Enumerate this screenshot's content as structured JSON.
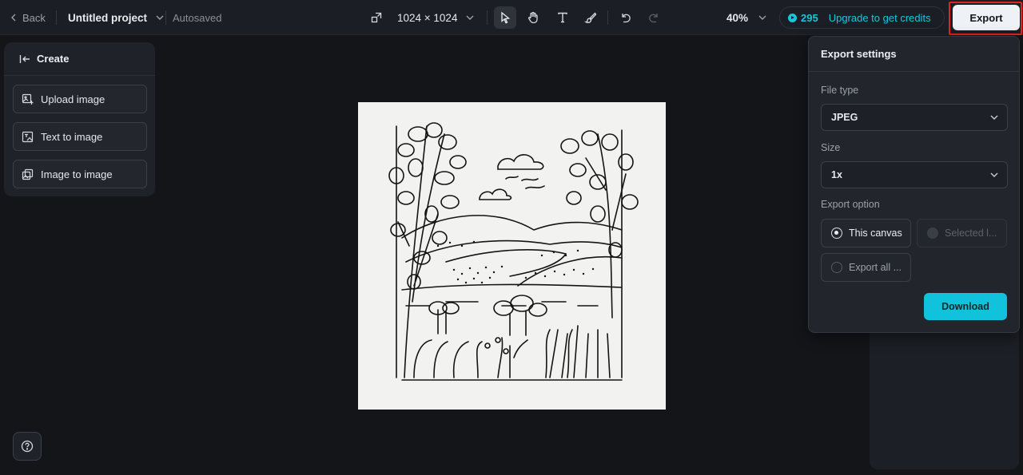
{
  "topbar": {
    "back_label": "Back",
    "project_name": "Untitled project",
    "status": "Autosaved",
    "canvas_size": "1024 × 1024",
    "zoom": "40%",
    "credits_count": "295",
    "upgrade_label": "Upgrade to get credits",
    "export_label": "Export",
    "tools": [
      "resize-icon",
      "select-arrow-icon",
      "hand-icon",
      "text-icon",
      "brush-icon",
      "undo-icon",
      "redo-icon"
    ],
    "active_tool": "select-arrow-icon"
  },
  "left_panel": {
    "header": "Create",
    "items": [
      {
        "label": "Upload image",
        "icon": "upload-image-icon"
      },
      {
        "label": "Text to image",
        "icon": "text-to-image-icon"
      },
      {
        "label": "Image to image",
        "icon": "image-to-image-icon"
      }
    ],
    "help_icon": "help-icon"
  },
  "export_panel": {
    "title": "Export settings",
    "file_type_label": "File type",
    "file_type_value": "JPEG",
    "size_label": "Size",
    "size_value": "1x",
    "export_option_label": "Export option",
    "options": [
      {
        "label": "This canvas",
        "state": "selected"
      },
      {
        "label": "Selected l...",
        "state": "disabled"
      },
      {
        "label": "Export all ...",
        "state": "unselected"
      }
    ],
    "download_label": "Download"
  },
  "colors": {
    "background": "#131519",
    "panel": "#22252c",
    "accent": "#19c6df",
    "highlight": "#e02424"
  }
}
